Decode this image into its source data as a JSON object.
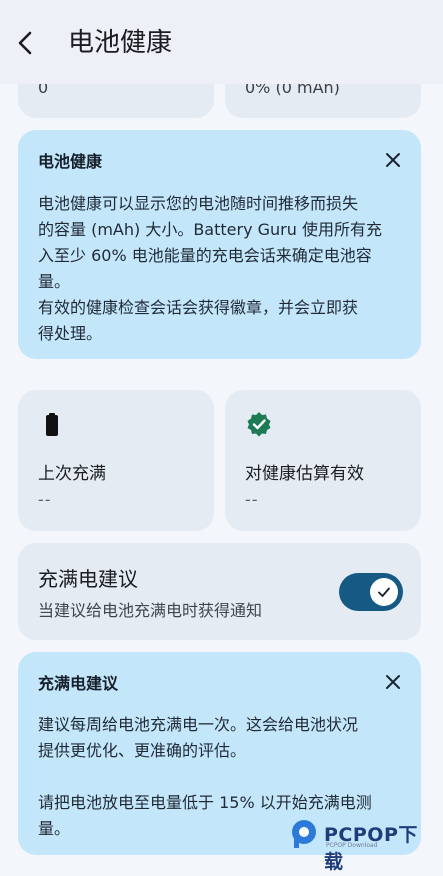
{
  "app_bar": {
    "title": "电池健康",
    "back_icon": "arrow-back-icon"
  },
  "top_row": {
    "left_value": "0",
    "right_value": "0% (0 mAh)"
  },
  "health_info": {
    "title": "电池健康",
    "body": "电池健康可以显示您的电池随时间推移而损失\n的容量 (mAh) 大小。Battery Guru 使用所有充\n入至少 60% 电池能量的充电会话来确定电池容\n量。\n有效的健康检查会话会获得徽章，并会立即获\n得处理。",
    "close_icon": "close-icon"
  },
  "stats": [
    {
      "icon": "battery-full-icon",
      "label": "上次充满",
      "value": "--"
    },
    {
      "icon": "verified-badge-icon",
      "label": "对健康估算有效",
      "value": "--"
    }
  ],
  "full_charge_toggle": {
    "title": "充满电建议",
    "subtitle": "当建议给电池充满电时获得通知",
    "enabled": true
  },
  "full_charge_info": {
    "title": "充满电建议",
    "body": "建议每周给电池充满电一次。这会给电池状况\n提供更优化、更准确的评估。\n\n请把电池放电至电量低于 15% 以开始充满电测\n量。",
    "close_icon": "close-icon"
  },
  "watermark": {
    "text": "PCPOP下载",
    "sub": "PCPOP Download"
  },
  "colors": {
    "accent": "#145a82",
    "info_card": "#c4e6fb",
    "grey_card": "#e5ebf3",
    "badge": "#1c7a55"
  }
}
